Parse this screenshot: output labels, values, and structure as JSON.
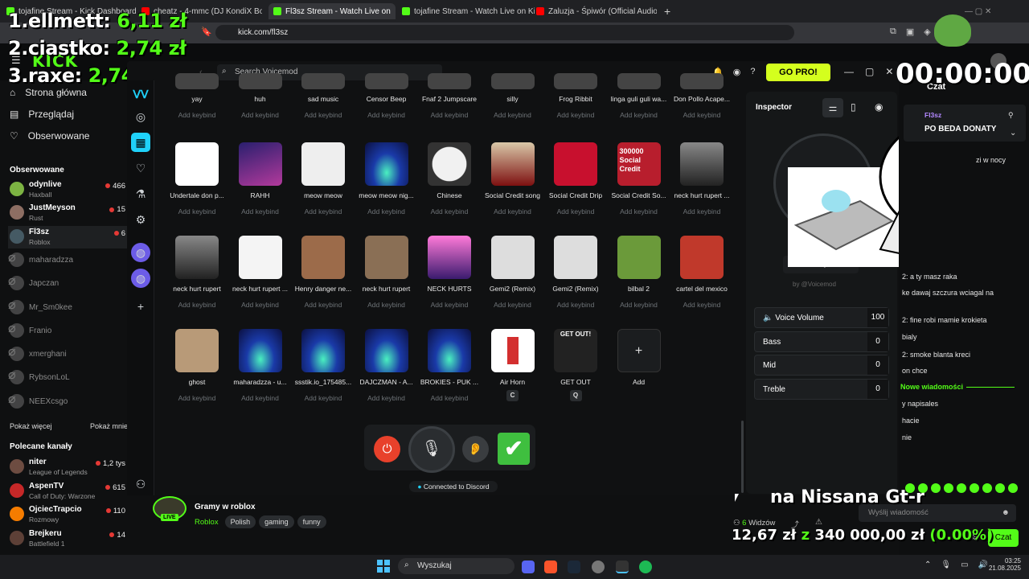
{
  "browser": {
    "tabs": [
      {
        "label": "tojafine Stream - Kick Dashboard",
        "color": "#53fc18"
      },
      {
        "label": "cheatz - 4-mmc (DJ KondiX Boot",
        "color": "#ff0000"
      },
      {
        "label": "Fl3sz Stream - Watch Live on",
        "color": "#53fc18"
      },
      {
        "label": "tojafine Stream - Watch Live on Kick",
        "color": "#53fc18"
      },
      {
        "label": "Zaluzja - Śpiwór (Official Audio) - Yo",
        "color": "#ff0000"
      }
    ],
    "url": "kick.com/fl3sz"
  },
  "overlay": {
    "lines": [
      {
        "rank": "1.",
        "name": "ellmett:",
        "amount": "6,11 zł"
      },
      {
        "rank": "2.",
        "name": "ciastko:",
        "amount": "2,74 zł"
      },
      {
        "rank": "3.",
        "name": "raxe:",
        "amount": "2,74 zł"
      }
    ],
    "timer": "00:00:00",
    "subtitle": "na Nissana Gt-r",
    "goal": {
      "current": "12,67 zł",
      "sep": "z",
      "target": "340 000,00 zł",
      "pct": "(0.00%)"
    }
  },
  "kick": {
    "logo": "KICK",
    "nav": [
      {
        "label": "Strona główna"
      },
      {
        "label": "Przeglądaj"
      },
      {
        "label": "Obserwowane"
      }
    ],
    "followed_title": "Obserwowane",
    "followed": [
      {
        "name": "odynlive",
        "cat": "Haxball",
        "viewers": "466",
        "color": "#7cb342"
      },
      {
        "name": "JustMeyson",
        "cat": "Rust",
        "viewers": "15",
        "color": "#8d6e63"
      },
      {
        "name": "Fl3sz",
        "cat": "Roblox",
        "viewers": "6",
        "color": "#455a64"
      },
      {
        "name": "maharadzza"
      },
      {
        "name": "Japczan"
      },
      {
        "name": "Mr_Sm0kee"
      },
      {
        "name": "Franio"
      },
      {
        "name": "xmerghani"
      },
      {
        "name": "RybsonLoL"
      },
      {
        "name": "NEEXcsgo"
      }
    ],
    "show_more": "Pokaż więcej",
    "show_less": "Pokaż mnie",
    "rec_title": "Polecane kanały",
    "recommended": [
      {
        "name": "niter",
        "cat": "League of Legends",
        "viewers": "1,2 tys",
        "color": "#6d4c41"
      },
      {
        "name": "AspenTV",
        "cat": "Call of Duty: Warzone",
        "viewers": "615",
        "color": "#c62828"
      },
      {
        "name": "OjciecTrapcio",
        "cat": "Rozmowy",
        "viewers": "110",
        "color": "#f57c00"
      },
      {
        "name": "Brejkeru",
        "cat": "Battlefield 1",
        "viewers": "14",
        "color": "#5d4037"
      }
    ],
    "stream": {
      "title": "Gramy w roblox",
      "category": "Roblox",
      "tags": [
        "Polish",
        "gaming",
        "funny"
      ],
      "live": "LIVE",
      "viewers": "6",
      "viewers_label": "Widzów"
    },
    "chat": {
      "title": "Czat",
      "streamer": "Fl3sz",
      "pinned": "PO BEDA DONATY",
      "msgs": [
        "zi w nocy",
        "2: a ty masz raka",
        "ke dawaj szczura wciagal na",
        "2: fine robi mamie krokieta",
        "bialy",
        "2: smoke blanta kreci",
        "on chce",
        "y napisales",
        "hacie",
        "nie"
      ],
      "new_msgs": "Nowe wiadomości",
      "placeholder": "Wyślij wiadomość",
      "send": "Czat"
    }
  },
  "voicemod": {
    "search_placeholder": "Search Voicemod",
    "gopro": "GO PRO!",
    "row0": [
      {
        "name": "yay",
        "key": "Add keybind"
      },
      {
        "name": "huh",
        "key": "Add keybind"
      },
      {
        "name": "sad music",
        "key": "Add keybind"
      },
      {
        "name": "Censor Beep",
        "key": "Add keybind"
      },
      {
        "name": "Fnaf 2 Jumpscare",
        "key": "Add keybind"
      },
      {
        "name": "silly",
        "key": "Add keybind"
      },
      {
        "name": "Frog Ribbit",
        "key": "Add keybind"
      },
      {
        "name": "linga guli guli wa...",
        "key": "Add keybind"
      },
      {
        "name": "Don Pollo Acape...",
        "key": "Add keybind"
      }
    ],
    "row1": [
      {
        "name": "Undertale don p...",
        "key": "Add keybind",
        "art": "ds"
      },
      {
        "name": "RAHH",
        "key": "Add keybind",
        "art": "night"
      },
      {
        "name": "meow meow",
        "key": "Add keybind",
        "art": "cat"
      },
      {
        "name": "meow meow nig...",
        "key": "Add keybind",
        "art": "wave"
      },
      {
        "name": "Chinese",
        "key": "Add keybind",
        "art": "plate"
      },
      {
        "name": "Social Credit song",
        "key": "Add keybind",
        "art": "red"
      },
      {
        "name": "Social Credit Drip",
        "key": "Add keybind",
        "art": "flag"
      },
      {
        "name": "Social Credit So...",
        "key": "Add keybind",
        "art": "credit"
      },
      {
        "name": "neck hurt rupert ...",
        "key": "Add keybind",
        "art": "rob"
      }
    ],
    "row2": [
      {
        "name": "neck hurt rupert",
        "key": "Add keybind",
        "art": "rob"
      },
      {
        "name": "neck hurt rupert ...",
        "key": "Add keybind",
        "art": "robw"
      },
      {
        "name": "Henry danger ne...",
        "key": "Add keybind",
        "art": "people"
      },
      {
        "name": "neck hurt rupert",
        "key": "Add keybind",
        "art": "face"
      },
      {
        "name": "NECK HURTS",
        "key": "Add keybind",
        "art": "pink"
      },
      {
        "name": "Gemi2 (Remix)",
        "key": "Add keybind",
        "art": "manga"
      },
      {
        "name": "Gemi2 (Remix)",
        "key": "Add keybind",
        "art": "manga"
      },
      {
        "name": "bilbal 2",
        "key": "Add keybind",
        "art": "bird"
      },
      {
        "name": "cartel del mexico",
        "key": "Add keybind",
        "art": "luffy"
      }
    ],
    "row3": [
      {
        "name": "ghost",
        "key": "Add keybind",
        "art": "catphoto"
      },
      {
        "name": "maharadzza - u...",
        "key": "Add keybind",
        "art": "wave"
      },
      {
        "name": "ssstik.io_175485...",
        "key": "Add keybind",
        "art": "wave"
      },
      {
        "name": "DAJCZMAN - A...",
        "key": "Add keybind",
        "art": "wave"
      },
      {
        "name": "BROKIES - PUK ...",
        "key": "Add keybind",
        "art": "wave"
      },
      {
        "name": "Air Horn",
        "key": "C",
        "art": "horn"
      },
      {
        "name": "GET OUT",
        "key": "Q",
        "art": "getout"
      },
      {
        "name": "Add",
        "key": "",
        "art": "add"
      }
    ],
    "getout_text": "GET OUT!",
    "credit_text": "300000 Social Credit",
    "status": "Connected to Discord",
    "inspector": {
      "title": "Inspector",
      "add_keybind": "Add keybind",
      "by": "by @Voicemod",
      "sliders": [
        {
          "label": "Voice Volume",
          "value": "100"
        },
        {
          "label": "Bass",
          "value": "0"
        },
        {
          "label": "Mid",
          "value": "0"
        },
        {
          "label": "Treble",
          "value": "0"
        }
      ]
    }
  },
  "taskbar": {
    "search": "Wyszukaj",
    "time": "03:25",
    "date": "21.08.2025"
  }
}
